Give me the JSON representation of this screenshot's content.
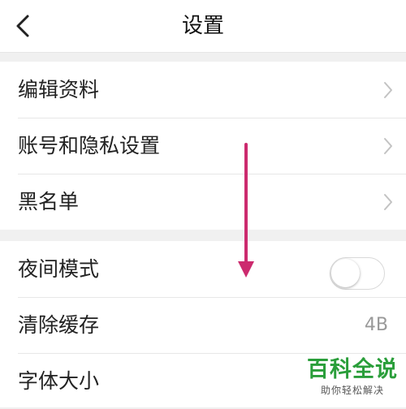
{
  "header": {
    "title": "设置",
    "back_icon": "chevron-left-icon"
  },
  "groups": [
    {
      "items": [
        {
          "label": "编辑资料",
          "accessory": "chevron-right-icon"
        },
        {
          "label": "账号和隐私设置",
          "accessory": "chevron-right-icon"
        },
        {
          "label": "黑名单",
          "accessory": "chevron-right-icon"
        }
      ]
    },
    {
      "items": [
        {
          "label": "夜间模式",
          "accessory": "toggle",
          "toggle_on": false
        },
        {
          "label": "清除缓存",
          "accessory": "value",
          "value": "4B"
        },
        {
          "label": "字体大小",
          "accessory": "none"
        }
      ]
    }
  ],
  "annotation": {
    "icon": "arrow-down-icon",
    "color": "#cc2a6e"
  },
  "watermark": {
    "brand": "百科全说",
    "slogan": "助你轻松解决",
    "color": "#2a9e3a"
  },
  "colors": {
    "background": "#f0f0f0",
    "card": "#ffffff",
    "divider": "#e7e7e7",
    "secondary_text": "#999999"
  }
}
